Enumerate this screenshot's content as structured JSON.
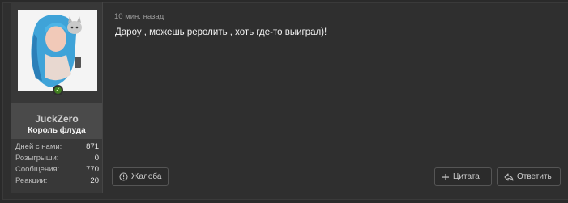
{
  "post": {
    "timestamp": "10 мин. назад",
    "message": "Дароу , можешь реролить , хоть где-то выиграл)!"
  },
  "user": {
    "name": "JuckZero",
    "title": "Король флуда",
    "stats": [
      {
        "label": "Дней с нами:",
        "value": "871"
      },
      {
        "label": "Розыгрыши:",
        "value": "0"
      },
      {
        "label": "Сообщения:",
        "value": "770"
      },
      {
        "label": "Реакции:",
        "value": "20"
      }
    ]
  },
  "actions": {
    "report_label": "Жалоба",
    "quote_label": "Цитата",
    "reply_label": "Ответить"
  },
  "icons": {
    "report": "alert-circle-icon",
    "quote": "plus-icon",
    "reply": "reply-icon",
    "status": "online-status-icon"
  },
  "colors": {
    "background": "#2a2a2a",
    "panel": "#383838",
    "name_block": "#4a4a4a",
    "status_green": "#3f7d1f"
  }
}
